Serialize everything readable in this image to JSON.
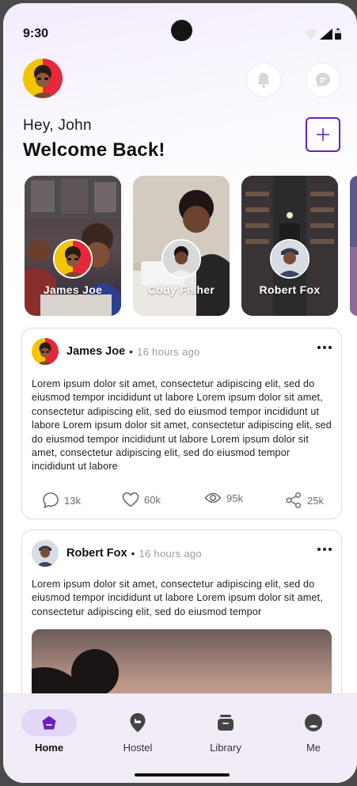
{
  "status_bar": {
    "time": "9:30"
  },
  "header": {
    "greeting": "Hey, John",
    "welcome": "Welcome Back!"
  },
  "stories": [
    {
      "name": "James Joe"
    },
    {
      "name": "Cody Fisher"
    },
    {
      "name": "Robert Fox"
    }
  ],
  "posts": [
    {
      "author": "James Joe",
      "separator": "•",
      "time": "16 hours ago",
      "text": "Lorem ipsum dolor sit amet, consectetur adipiscing elit, sed do eiusmod tempor incididunt ut labore Lorem ipsum dolor sit amet, consectetur adipiscing elit, sed do eiusmod tempor incididunt ut labore Lorem ipsum dolor sit amet, consectetur adipiscing elit, sed do eiusmod tempor incididunt ut labore Lorem ipsum dolor sit amet, consectetur adipiscing elit, sed do eiusmod tempor incididunt ut labore",
      "comments": "13k",
      "likes": "60k",
      "views": "95k",
      "shares": "25k"
    },
    {
      "author": "Robert Fox",
      "separator": "•",
      "time": "16 hours ago",
      "text": "Lorem ipsum dolor sit amet, consectetur adipiscing elit, sed do eiusmod tempor incididunt ut labore Lorem ipsum dolor sit amet, consectetur adipiscing elit, sed do eiusmod tempor"
    }
  ],
  "bottom_nav": {
    "items": [
      {
        "label": "Home",
        "icon": "home-icon",
        "active": true
      },
      {
        "label": "Hostel",
        "icon": "hostel-icon",
        "active": false
      },
      {
        "label": "Library",
        "icon": "library-icon",
        "active": false
      },
      {
        "label": "Me",
        "icon": "profile-icon",
        "active": false
      }
    ]
  },
  "colors": {
    "accent": "#6a1fc4",
    "active_pill": "#e3d6f7",
    "nav_background": "#f1ecf6"
  }
}
